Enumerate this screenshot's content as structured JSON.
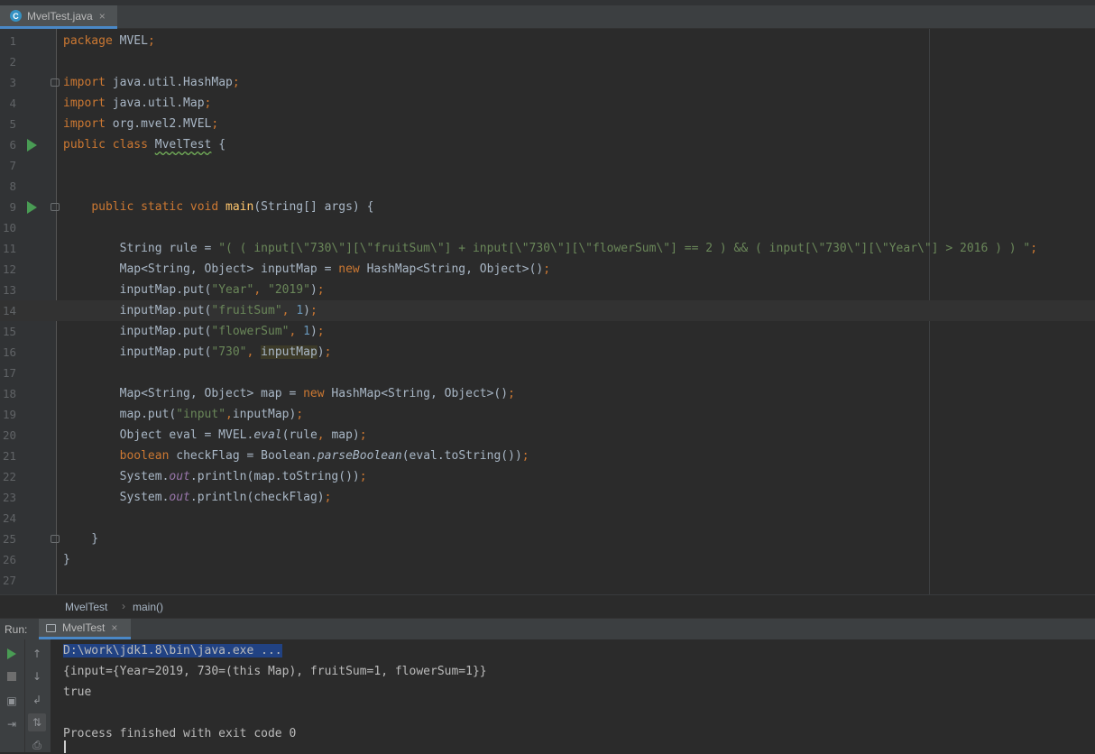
{
  "editor_tab": {
    "icon": "class-file-icon",
    "label": "MvelTest.java",
    "close": "×"
  },
  "code_lines": [
    {
      "n": "1",
      "segs": [
        {
          "c": "kw",
          "t": "package"
        },
        {
          "t": " MVEL"
        },
        {
          "c": "kw",
          "t": ";"
        }
      ]
    },
    {
      "n": "2",
      "segs": []
    },
    {
      "n": "3",
      "segs": [
        {
          "c": "kw",
          "t": "import"
        },
        {
          "t": " java.util.HashMap"
        },
        {
          "c": "kw",
          "t": ";"
        }
      ]
    },
    {
      "n": "4",
      "segs": [
        {
          "c": "kw",
          "t": "import"
        },
        {
          "t": " java.util.Map"
        },
        {
          "c": "kw",
          "t": ";"
        }
      ]
    },
    {
      "n": "5",
      "segs": [
        {
          "c": "kw",
          "t": "import"
        },
        {
          "t": " org.mvel2.MVEL"
        },
        {
          "c": "kw",
          "t": ";"
        }
      ]
    },
    {
      "n": "6",
      "segs": [
        {
          "c": "kw",
          "t": "public class "
        },
        {
          "c": "wavy",
          "t": "MvelTest"
        },
        {
          "t": " {"
        }
      ]
    },
    {
      "n": "7",
      "segs": []
    },
    {
      "n": "8",
      "segs": []
    },
    {
      "n": "9",
      "segs": [
        {
          "t": "    "
        },
        {
          "c": "kw",
          "t": "public static void "
        },
        {
          "c": "fn",
          "t": "main"
        },
        {
          "t": "(String[] args) {"
        }
      ]
    },
    {
      "n": "10",
      "segs": []
    },
    {
      "n": "11",
      "segs": [
        {
          "t": "        String rule = "
        },
        {
          "c": "str",
          "t": "\"( ( input[\\\"730\\\"][\\\"fruitSum\\\"] + input[\\\"730\\\"][\\\"flowerSum\\\"] == 2 ) && ( input[\\\"730\\\"][\\\"Year\\\"] > 2016 ) ) \""
        },
        {
          "c": "kw",
          "t": ";"
        }
      ]
    },
    {
      "n": "12",
      "segs": [
        {
          "t": "        Map<String, Object> inputMap = "
        },
        {
          "c": "kw",
          "t": "new "
        },
        {
          "t": "HashMap<String, Object>()"
        },
        {
          "c": "kw",
          "t": ";"
        }
      ]
    },
    {
      "n": "13",
      "segs": [
        {
          "t": "        inputMap.put("
        },
        {
          "c": "str",
          "t": "\"Year\""
        },
        {
          "c": "kw",
          "t": ", "
        },
        {
          "c": "str",
          "t": "\"2019\""
        },
        {
          "t": ")"
        },
        {
          "c": "kw",
          "t": ";"
        }
      ]
    },
    {
      "n": "14",
      "segs": [
        {
          "t": "        inputMap.put("
        },
        {
          "c": "str",
          "t": "\"fruitSum\""
        },
        {
          "c": "kw",
          "t": ", "
        },
        {
          "c": "num",
          "t": "1"
        },
        {
          "t": ")"
        },
        {
          "c": "kw",
          "t": ";"
        }
      ]
    },
    {
      "n": "15",
      "segs": [
        {
          "t": "        inputMap.put("
        },
        {
          "c": "str",
          "t": "\"flowerSum\""
        },
        {
          "c": "kw",
          "t": ", "
        },
        {
          "c": "num",
          "t": "1"
        },
        {
          "t": ")"
        },
        {
          "c": "kw",
          "t": ";"
        }
      ]
    },
    {
      "n": "16",
      "segs": [
        {
          "t": "        inputMap.put("
        },
        {
          "c": "str",
          "t": "\"730\""
        },
        {
          "c": "kw",
          "t": ", "
        },
        {
          "c": "hl",
          "t": "inputMap"
        },
        {
          "t": ")"
        },
        {
          "c": "kw",
          "t": ";"
        }
      ]
    },
    {
      "n": "17",
      "segs": []
    },
    {
      "n": "18",
      "segs": [
        {
          "t": "        Map<String, Object> map = "
        },
        {
          "c": "kw",
          "t": "new "
        },
        {
          "t": "HashMap<String, Object>()"
        },
        {
          "c": "kw",
          "t": ";"
        }
      ]
    },
    {
      "n": "19",
      "segs": [
        {
          "t": "        map.put("
        },
        {
          "c": "str",
          "t": "\"input\""
        },
        {
          "c": "kw",
          "t": ","
        },
        {
          "t": "inputMap)"
        },
        {
          "c": "kw",
          "t": ";"
        }
      ]
    },
    {
      "n": "20",
      "segs": [
        {
          "t": "        Object eval = MVEL."
        },
        {
          "c": "ital",
          "t": "eval"
        },
        {
          "t": "(rule"
        },
        {
          "c": "kw",
          "t": ", "
        },
        {
          "t": "map)"
        },
        {
          "c": "kw",
          "t": ";"
        }
      ]
    },
    {
      "n": "21",
      "segs": [
        {
          "t": "        "
        },
        {
          "c": "kw",
          "t": "boolean "
        },
        {
          "t": "checkFlag = Boolean."
        },
        {
          "c": "ital",
          "t": "parseBoolean"
        },
        {
          "t": "(eval.toString())"
        },
        {
          "c": "kw",
          "t": ";"
        }
      ]
    },
    {
      "n": "22",
      "segs": [
        {
          "t": "        System."
        },
        {
          "c": "fld",
          "t": "out"
        },
        {
          "t": ".println(map.toString())"
        },
        {
          "c": "kw",
          "t": ";"
        }
      ]
    },
    {
      "n": "23",
      "segs": [
        {
          "t": "        System."
        },
        {
          "c": "fld",
          "t": "out"
        },
        {
          "t": ".println(checkFlag)"
        },
        {
          "c": "kw",
          "t": ";"
        }
      ]
    },
    {
      "n": "24",
      "segs": []
    },
    {
      "n": "25",
      "segs": [
        {
          "t": "    }"
        }
      ]
    },
    {
      "n": "26",
      "segs": [
        {
          "t": "}"
        }
      ]
    },
    {
      "n": "27",
      "segs": []
    }
  ],
  "breadcrumb": {
    "class_name": "MvelTest",
    "separator": "›",
    "method": "main()"
  },
  "run_panel": {
    "label": "Run:",
    "tab_label": "MvelTest",
    "tab_close": "×",
    "toolbar_icons": [
      "rerun-icon",
      "up-arrow-icon",
      "stop-icon",
      "down-arrow-icon",
      "camera-icon",
      "soft-wrap-icon",
      "login-icon",
      "sort-icon",
      "print-icon"
    ],
    "output": [
      "D:\\work\\jdk1.8\\bin\\java.exe ...",
      "{input={Year=2019, 730=(this Map), fruitSum=1, flowerSum=1}}",
      "true",
      "",
      "Process finished with exit code 0"
    ]
  }
}
